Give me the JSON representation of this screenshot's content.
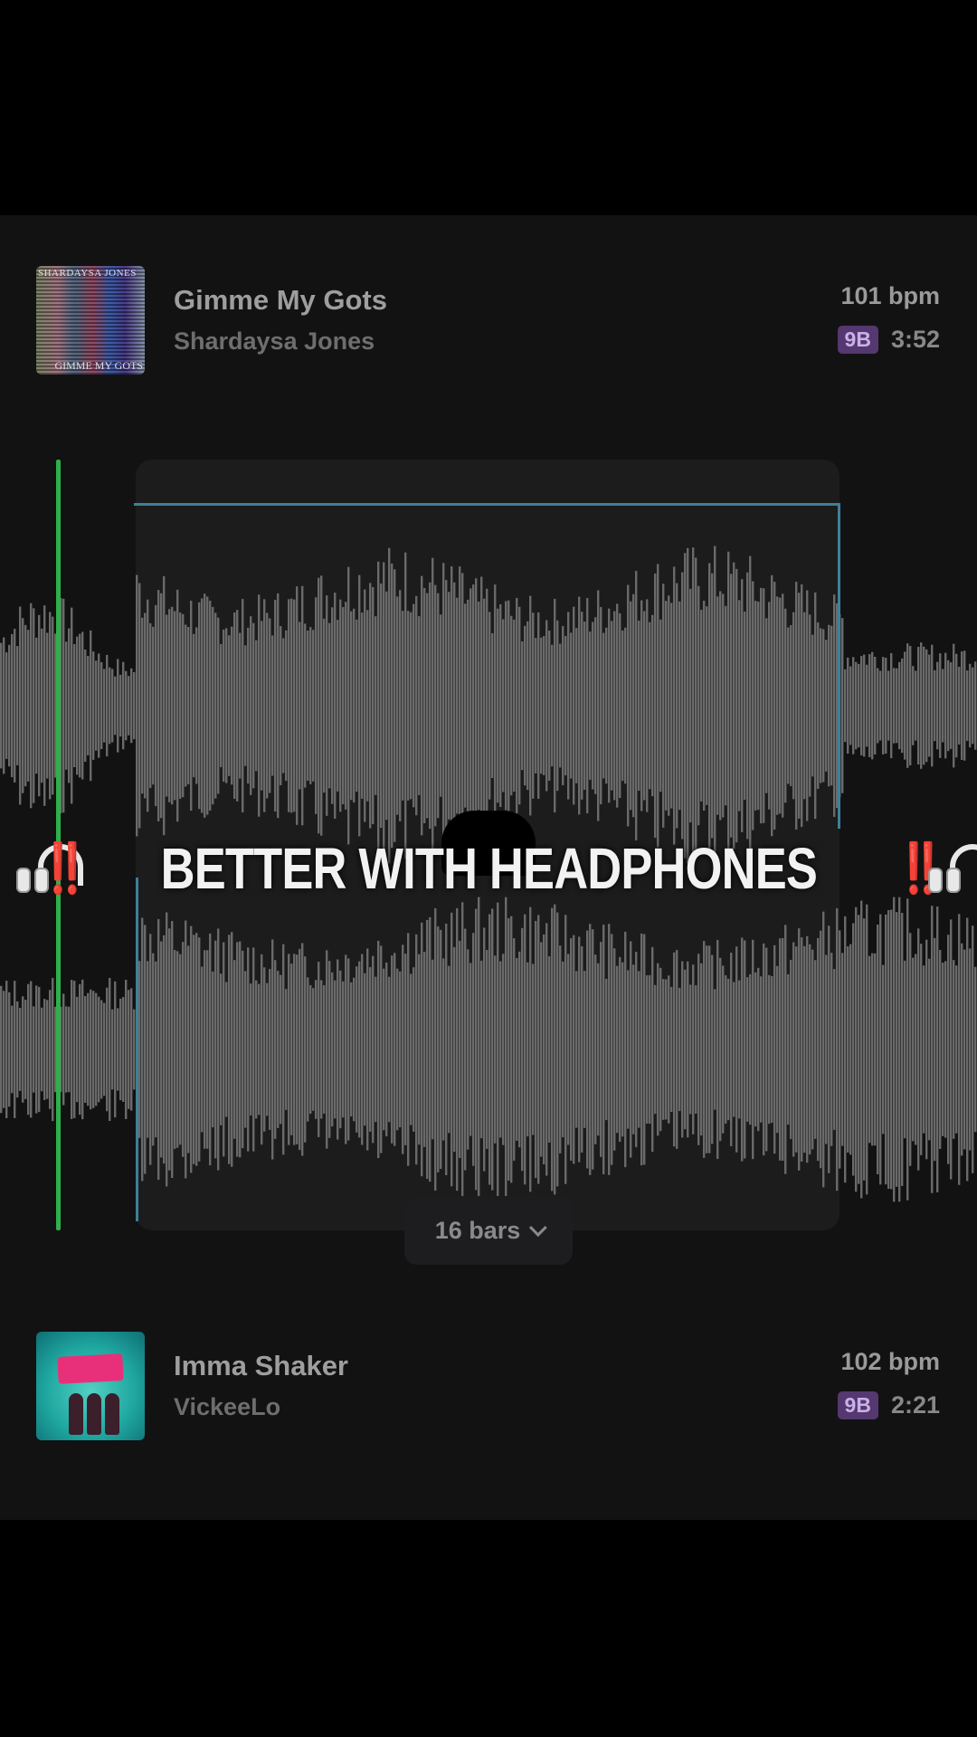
{
  "tracks": [
    {
      "title": "Gimme My Gots",
      "artist": "Shardaysa Jones",
      "bpm": "101 bpm",
      "key": "9B",
      "duration": "3:52",
      "artwork_text_top": "SHARDAYSA JONES",
      "artwork_text_bottom": "GIMME MY GOTS"
    },
    {
      "title": "Imma Shaker",
      "artist": "VickeeLo",
      "bpm": "102 bpm",
      "key": "9B",
      "duration": "2:21"
    }
  ],
  "loop": {
    "length_label": "16 bars"
  },
  "overlay": {
    "caption": "BETTER WITH HEADPHONES",
    "left_mark": "‼️",
    "right_mark": "‼️",
    "icon": "headphone-icon"
  },
  "colors": {
    "playhead": "#2fb04a",
    "loop_outline": "#3f7f96",
    "key_badge": "#54386f",
    "waveform": "#6a6a6a"
  }
}
